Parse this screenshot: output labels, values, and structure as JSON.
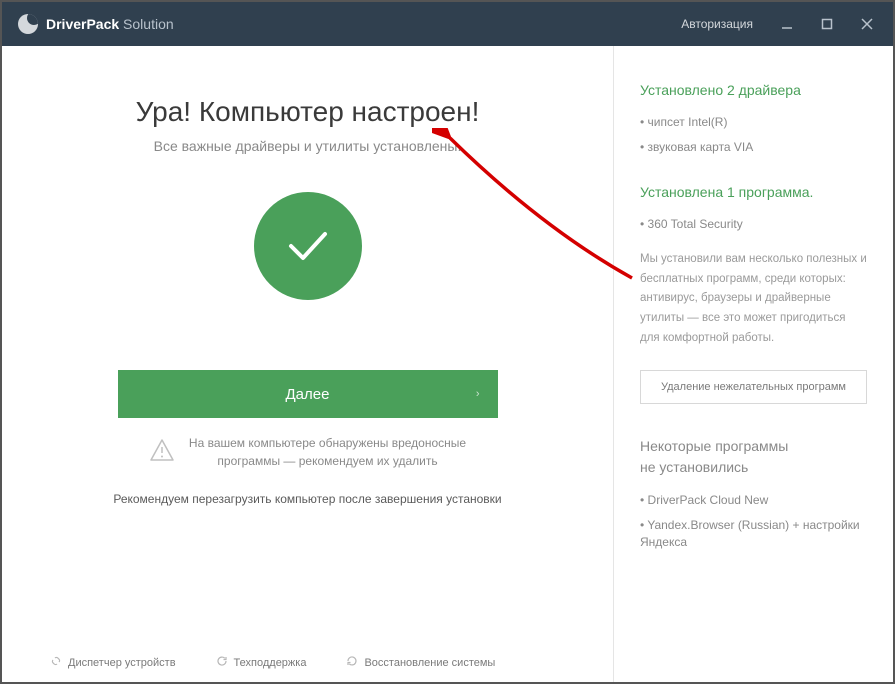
{
  "app": {
    "name_bold": "DriverPack",
    "name_thin": " Solution",
    "auth": "Авторизация"
  },
  "main": {
    "title": "Ура! Компьютер настроен!",
    "subtitle": "Все важные драйверы и утилиты установлены.",
    "next": "Далее",
    "warning_line1": "На вашем компьютере обнаружены вредоносные",
    "warning_line2": "программы — рекомендуем их удалить",
    "reboot": "Рекомендуем перезагрузить компьютер после завершения установки"
  },
  "footer": {
    "devmgr": "Диспетчер устройств",
    "support": "Техподдержка",
    "restore": "Восстановление системы"
  },
  "sidebar": {
    "drivers_heading": "Установлено 2 драйвера",
    "drivers": [
      "чипсет Intel(R)",
      "звуковая карта VIA"
    ],
    "programs_heading": "Установлена 1 программа.",
    "programs": [
      "360 Total Security"
    ],
    "desc": "Мы установили вам несколько полезных и бесплатных программ, среди которых: антивирус, браузеры и драйверные утилиты — все это может пригодиться для комфортной работы.",
    "remove_btn": "Удаление нежелательных программ",
    "failed_heading_l1": "Некоторые программы",
    "failed_heading_l2": "не установились",
    "failed": [
      "DriverPack Cloud New",
      "Yandex.Browser (Russian) + настройки Яндекса"
    ]
  }
}
